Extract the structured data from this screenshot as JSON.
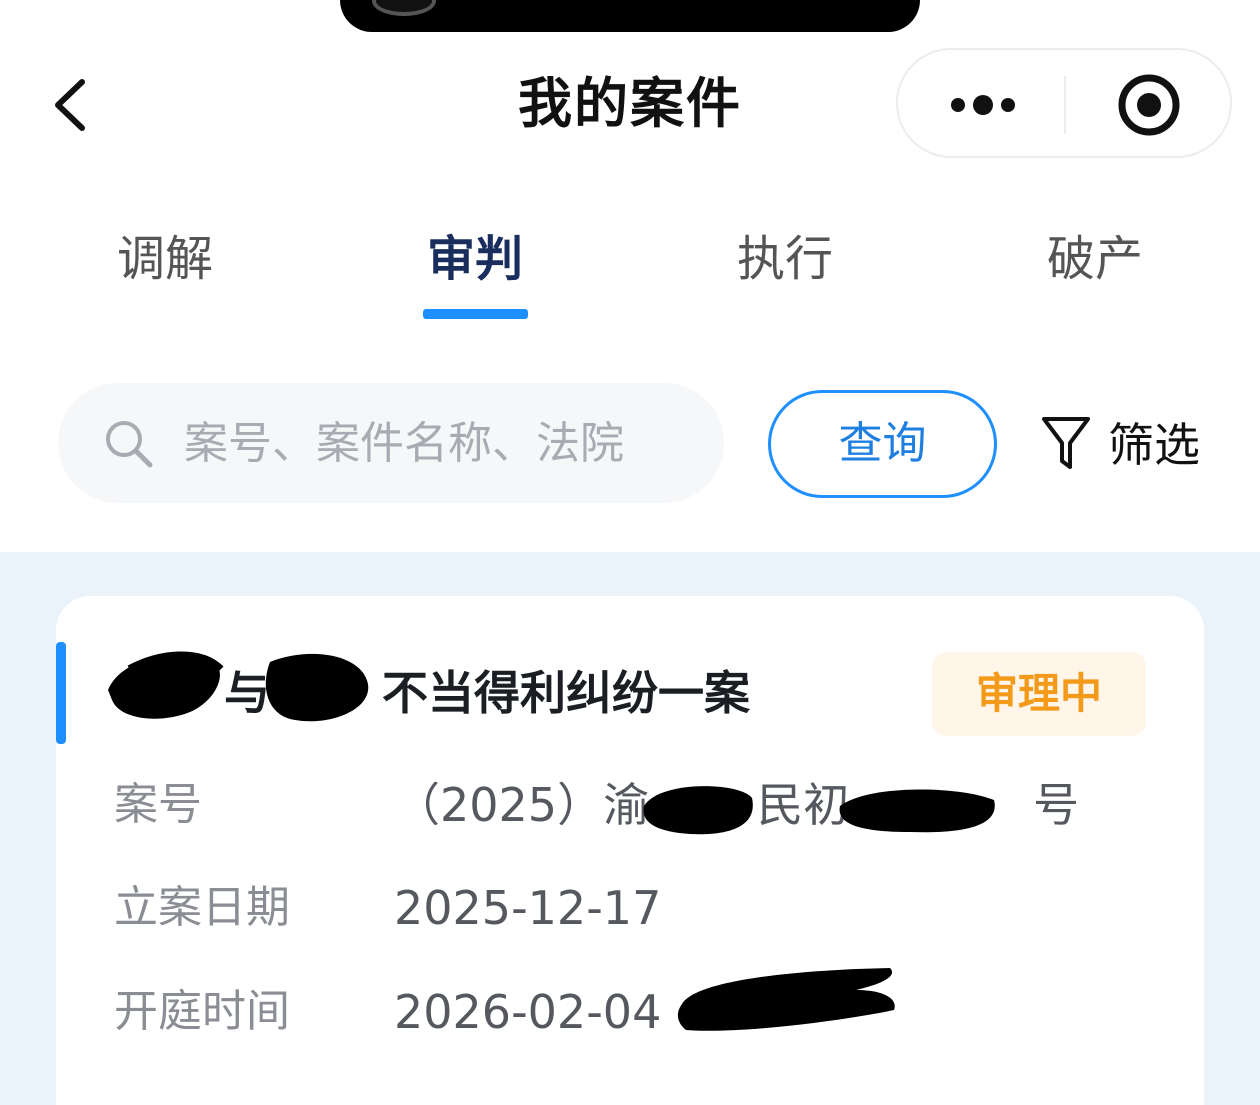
{
  "header": {
    "title": "我的案件",
    "back_icon": "chevron-left-icon",
    "more_icon": "more-dots-icon",
    "target_icon": "record-target-icon"
  },
  "tabs": [
    {
      "label": "调解",
      "active": false
    },
    {
      "label": "审判",
      "active": true
    },
    {
      "label": "执行",
      "active": false
    },
    {
      "label": "破产",
      "active": false
    }
  ],
  "search": {
    "placeholder": "案号、案件名称、法院",
    "value": "",
    "button_label": "查询"
  },
  "filter": {
    "label": "筛选",
    "icon": "funnel-icon"
  },
  "colors": {
    "accent": "#1e8fff",
    "status_orange": "#f39a1a",
    "list_background": "#eaf2fa"
  },
  "case": {
    "title_part1": "与",
    "title_part2": "不当得利纠纷一案",
    "status": "审理中",
    "fields": {
      "case_no_label": "案号",
      "case_no_prefix": "（2025）渝",
      "case_no_mid": "民初",
      "case_no_suffix": "号",
      "filing_date_label": "立案日期",
      "filing_date": "2025-12-17",
      "hearing_time_label": "开庭时间",
      "hearing_time": "2026-02-04"
    }
  }
}
